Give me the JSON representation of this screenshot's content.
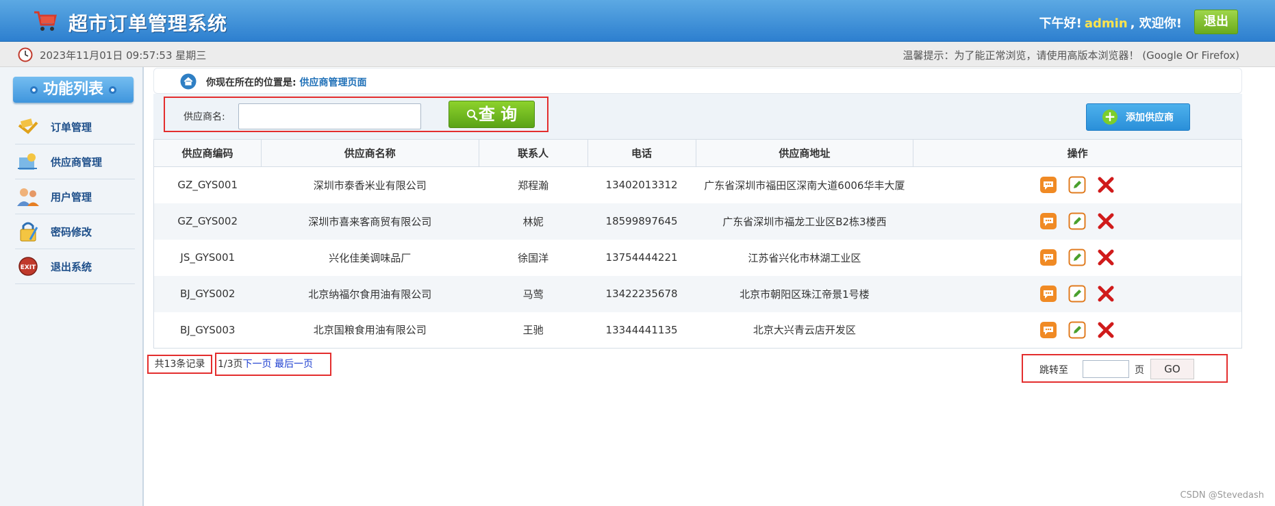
{
  "header": {
    "title": "超市订单管理系统",
    "greeting_prefix": "下午好!",
    "username": "admin",
    "greeting_suffix": ", 欢迎你!",
    "logout_label": "退出"
  },
  "timebar": {
    "datetime": "2023年11月01日 09:57:53 星期三",
    "tip": "温馨提示：为了能正常浏览，请使用高版本浏览器！ (Google Or Firefox)"
  },
  "sidebar": {
    "title": "功能列表",
    "items": [
      {
        "label": "订单管理",
        "icon": "order-icon"
      },
      {
        "label": "供应商管理",
        "icon": "provider-icon"
      },
      {
        "label": "用户管理",
        "icon": "users-icon"
      },
      {
        "label": "密码修改",
        "icon": "lock-icon"
      },
      {
        "label": "退出系统",
        "icon": "exit-icon"
      }
    ]
  },
  "breadcrumb": {
    "prefix": "你现在所在的位置是:",
    "current": "供应商管理页面"
  },
  "search": {
    "label": "供应商名:",
    "value": "",
    "placeholder": "",
    "query_label": "查 询",
    "add_label": "添加供应商"
  },
  "table": {
    "columns": [
      "供应商编码",
      "供应商名称",
      "联系人",
      "电话",
      "供应商地址",
      "操作"
    ],
    "rows": [
      {
        "code": "GZ_GYS001",
        "name": "深圳市泰香米业有限公司",
        "contact": "郑程瀚",
        "phone": "13402013312",
        "address": "广东省深圳市福田区深南大道6006华丰大厦"
      },
      {
        "code": "GZ_GYS002",
        "name": "深圳市喜来客商贸有限公司",
        "contact": "林妮",
        "phone": "18599897645",
        "address": "广东省深圳市福龙工业区B2栋3楼西"
      },
      {
        "code": "JS_GYS001",
        "name": "兴化佳美调味品厂",
        "contact": "徐国洋",
        "phone": "13754444221",
        "address": "江苏省兴化市林湖工业区"
      },
      {
        "code": "BJ_GYS002",
        "name": "北京纳福尔食用油有限公司",
        "contact": "马莺",
        "phone": "13422235678",
        "address": "北京市朝阳区珠江帝景1号楼"
      },
      {
        "code": "BJ_GYS003",
        "name": "北京国粮食用油有限公司",
        "contact": "王驰",
        "phone": "13344441135",
        "address": "北京大兴青云店开发区"
      }
    ]
  },
  "pager": {
    "total": "共13条记录",
    "current": "1/3页",
    "next": "下一页",
    "last": "最后一页",
    "jump_label": "跳转至",
    "jump_value": "",
    "jump_unit": "页",
    "go_label": "GO"
  },
  "watermark": "CSDN @Stevedash",
  "colors": {
    "header_blue": "#3a8ad6",
    "accent_green": "#6aab1e",
    "username_yellow": "#ffe44d",
    "highlight_red": "#e32d2d",
    "link_blue": "#1e6fb7"
  }
}
